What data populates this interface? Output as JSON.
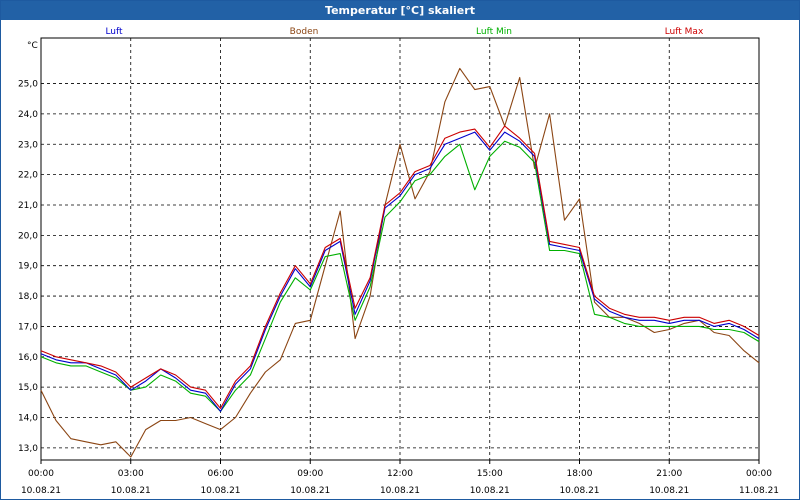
{
  "window": {
    "title": "Temperatur [°C] skaliert"
  },
  "colors": {
    "luft": "#0000cc",
    "boden": "#8b4513",
    "luft_min": "#00b000",
    "luft_max": "#cc0000",
    "titlebar": "#2261a6"
  },
  "chart_data": {
    "type": "line",
    "title": "Temperatur [°C] skaliert",
    "ylabel": "°C",
    "xlabel": "",
    "ylim": [
      12.6,
      26.5
    ],
    "xlim": [
      0,
      24
    ],
    "yticks": [
      "13,0",
      "14,0",
      "15,0",
      "16,0",
      "17,0",
      "18,0",
      "19,0",
      "20,0",
      "21,0",
      "22,0",
      "23,0",
      "24,0",
      "25,0"
    ],
    "xticks": [
      {
        "time": "00:00",
        "date": "10.08.21",
        "hour": 0
      },
      {
        "time": "03:00",
        "date": "10.08.21",
        "hour": 3
      },
      {
        "time": "06:00",
        "date": "10.08.21",
        "hour": 6
      },
      {
        "time": "09:00",
        "date": "10.08.21",
        "hour": 9
      },
      {
        "time": "12:00",
        "date": "10.08.21",
        "hour": 12
      },
      {
        "time": "15:00",
        "date": "10.08.21",
        "hour": 15
      },
      {
        "time": "18:00",
        "date": "10.08.21",
        "hour": 18
      },
      {
        "time": "21:00",
        "date": "10.08.21",
        "hour": 21
      },
      {
        "time": "00:00",
        "date": "11.08.21",
        "hour": 24
      }
    ],
    "grid": true,
    "legend_position": "top",
    "x": [
      0,
      0.5,
      1,
      1.5,
      2,
      2.5,
      3,
      3.5,
      4,
      4.5,
      5,
      5.5,
      6,
      6.5,
      7,
      7.5,
      8,
      8.5,
      9,
      9.5,
      10,
      10.5,
      11,
      11.5,
      12,
      12.5,
      13,
      13.5,
      14,
      14.5,
      15,
      15.5,
      16,
      16.5,
      17,
      17.5,
      18,
      18.5,
      19,
      19.5,
      20,
      20.5,
      21,
      21.5,
      22,
      22.5,
      23,
      23.5,
      24
    ],
    "series": [
      {
        "name": "Luft",
        "color_key": "luft",
        "values": [
          16.1,
          15.9,
          15.8,
          15.8,
          15.6,
          15.4,
          14.9,
          15.2,
          15.6,
          15.3,
          14.9,
          14.8,
          14.2,
          15.1,
          15.6,
          16.9,
          18.0,
          18.9,
          18.3,
          19.5,
          19.8,
          17.4,
          18.5,
          20.9,
          21.3,
          22.0,
          22.2,
          23.0,
          23.2,
          23.4,
          22.8,
          23.4,
          23.1,
          22.6,
          19.7,
          19.6,
          19.5,
          17.9,
          17.5,
          17.3,
          17.2,
          17.2,
          17.1,
          17.2,
          17.2,
          17.0,
          17.1,
          16.9,
          16.6
        ]
      },
      {
        "name": "Boden",
        "color_key": "boden",
        "values": [
          14.9,
          13.9,
          13.3,
          13.2,
          13.1,
          13.2,
          12.7,
          13.6,
          13.9,
          13.9,
          14.0,
          13.8,
          13.6,
          14.0,
          14.8,
          15.5,
          15.9,
          17.1,
          17.2,
          19.0,
          20.8,
          16.6,
          18.0,
          21.0,
          23.0,
          21.2,
          22.1,
          24.4,
          25.5,
          24.8,
          24.9,
          23.6,
          25.2,
          22.2,
          24.0,
          20.5,
          21.2,
          17.8,
          17.3,
          17.3,
          17.1,
          16.8,
          16.9,
          17.1,
          17.2,
          16.8,
          16.7,
          16.2,
          15.8
        ]
      },
      {
        "name": "Luft Min",
        "color_key": "luft_min",
        "values": [
          16.0,
          15.8,
          15.7,
          15.7,
          15.5,
          15.3,
          14.9,
          15.0,
          15.4,
          15.2,
          14.8,
          14.7,
          14.2,
          14.9,
          15.4,
          16.6,
          17.8,
          18.6,
          18.2,
          19.3,
          19.4,
          17.2,
          18.3,
          20.6,
          21.1,
          21.8,
          22.0,
          22.6,
          23.0,
          21.5,
          22.6,
          23.1,
          22.9,
          22.4,
          19.5,
          19.5,
          19.4,
          17.4,
          17.3,
          17.1,
          17.0,
          17.0,
          17.0,
          17.0,
          17.0,
          16.9,
          16.9,
          16.8,
          16.5
        ]
      },
      {
        "name": "Luft Max",
        "color_key": "luft_max",
        "values": [
          16.2,
          16.0,
          15.9,
          15.8,
          15.7,
          15.5,
          15.0,
          15.3,
          15.6,
          15.4,
          15.0,
          14.9,
          14.3,
          15.2,
          15.7,
          17.0,
          18.1,
          19.0,
          18.4,
          19.6,
          19.9,
          17.6,
          18.6,
          21.0,
          21.4,
          22.1,
          22.3,
          23.2,
          23.4,
          23.5,
          22.9,
          23.6,
          23.2,
          22.7,
          19.8,
          19.7,
          19.6,
          18.0,
          17.6,
          17.4,
          17.3,
          17.3,
          17.2,
          17.3,
          17.3,
          17.1,
          17.2,
          17.0,
          16.7
        ]
      }
    ]
  }
}
